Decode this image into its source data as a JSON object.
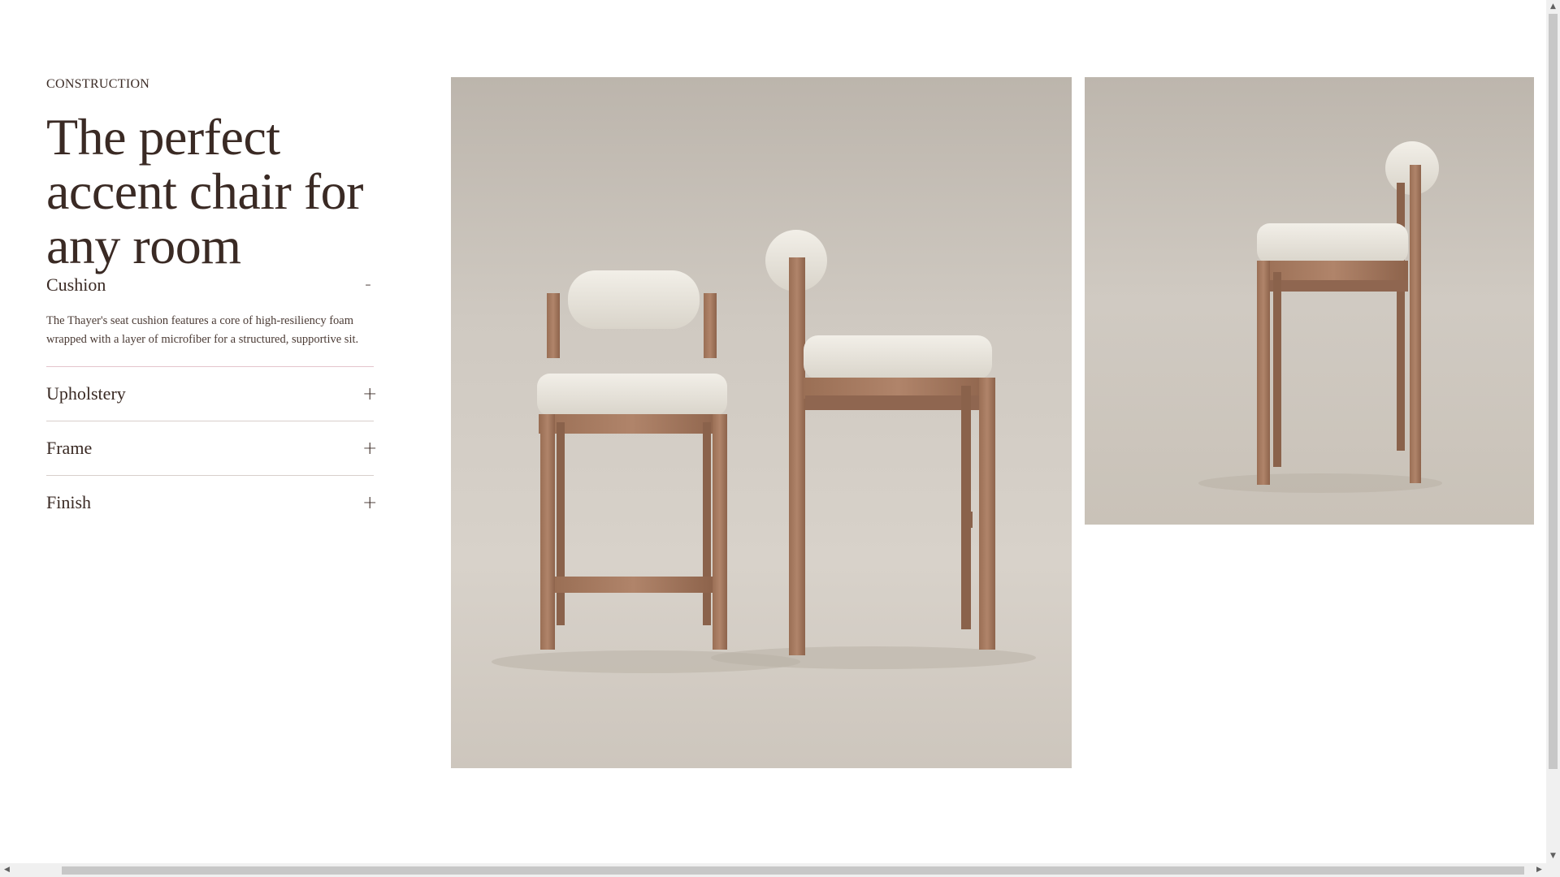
{
  "section": {
    "eyebrow": "CONSTRUCTION",
    "headline": "The perfect accent chair for any room"
  },
  "accordion": [
    {
      "label": "Cushion",
      "sign": "-",
      "open": true,
      "body": "The Thayer's seat cushion features a core of high-resiliency foam wrapped with a layer of microfiber for a structured, supportive sit."
    },
    {
      "label": "Upholstery",
      "sign": "+",
      "open": false
    },
    {
      "label": "Frame",
      "sign": "+",
      "open": false
    },
    {
      "label": "Finish",
      "sign": "+",
      "open": false
    }
  ],
  "scrollbars": {
    "up_arrow": "▲",
    "down_arrow": "▼",
    "left_arrow": "◀",
    "right_arrow": "▶"
  }
}
